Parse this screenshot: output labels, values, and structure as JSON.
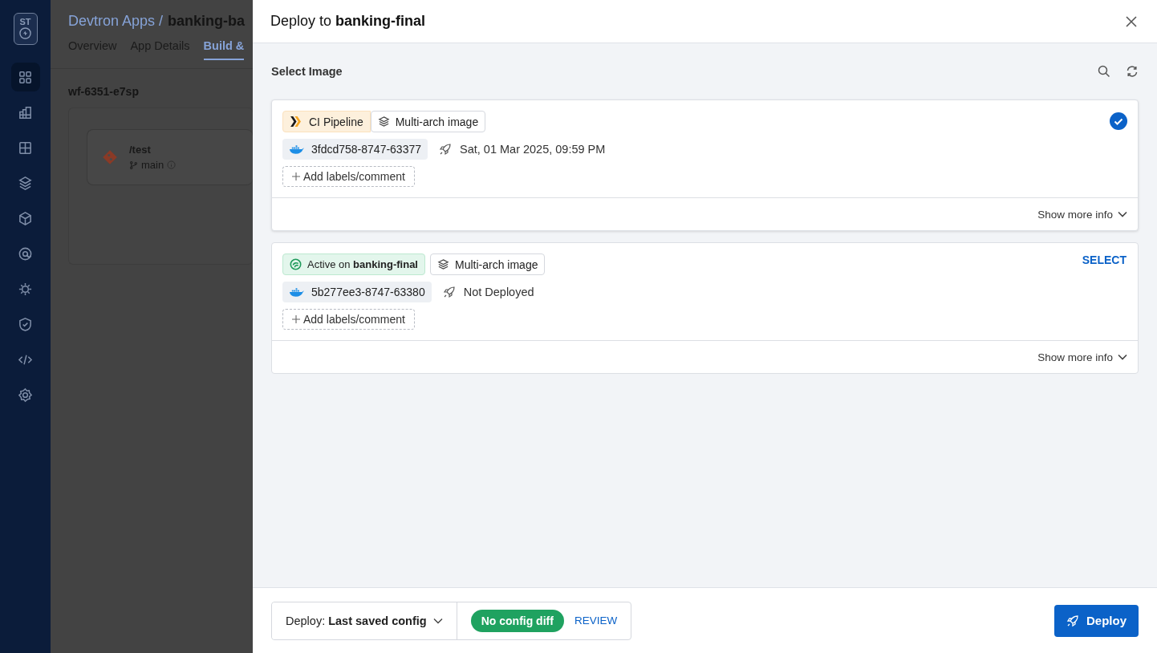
{
  "sidebar": {
    "logo": "ST",
    "items": [
      {
        "kind": "apps",
        "selected": true
      },
      {
        "kind": "chart",
        "selected": false
      },
      {
        "kind": "grid",
        "selected": false
      },
      {
        "kind": "stack",
        "selected": false
      },
      {
        "kind": "cube",
        "selected": false
      },
      {
        "kind": "target",
        "selected": false
      },
      {
        "kind": "sun",
        "selected": false
      },
      {
        "kind": "shield",
        "selected": false
      },
      {
        "kind": "code",
        "selected": false
      },
      {
        "kind": "gear",
        "selected": false
      }
    ]
  },
  "background": {
    "breadcrumb": "Devtron Apps /",
    "app_name": "banking-ba",
    "tabs": [
      {
        "label": "Overview",
        "selected": false
      },
      {
        "label": "App Details",
        "selected": false
      },
      {
        "label": "Build &",
        "selected": true
      }
    ],
    "workflow": {
      "name": "wf-6351-e7sp",
      "source": {
        "path": "/test",
        "branch": "main"
      }
    }
  },
  "drawer": {
    "title": "Deploy to **banking-final**",
    "section_title": "Select Image",
    "images": [
      {
        "selected": true,
        "source": {
          "kind": "pipeline",
          "label": "CI Pipeline"
        },
        "tag": "Multi-arch image",
        "digest": "3fdcd758-8747-63377",
        "deployed": "Sat, 01 Mar 2025, 09:59 PM",
        "add_label": "Add labels/comment",
        "more": "Show more info"
      },
      {
        "selected": false,
        "source": {
          "kind": "active",
          "label": "Active on **banking-final**"
        },
        "tag": "Multi-arch image",
        "digest": "5b277ee3-8747-63380",
        "deployed": "Not Deployed",
        "add_label": "Add labels/comment",
        "more": "Show more info",
        "select_label": "SELECT"
      }
    ],
    "footer": {
      "config": "Deploy: **Last saved config**",
      "diff": "No config diff",
      "review": "REVIEW",
      "deploy": "Deploy"
    }
  }
}
